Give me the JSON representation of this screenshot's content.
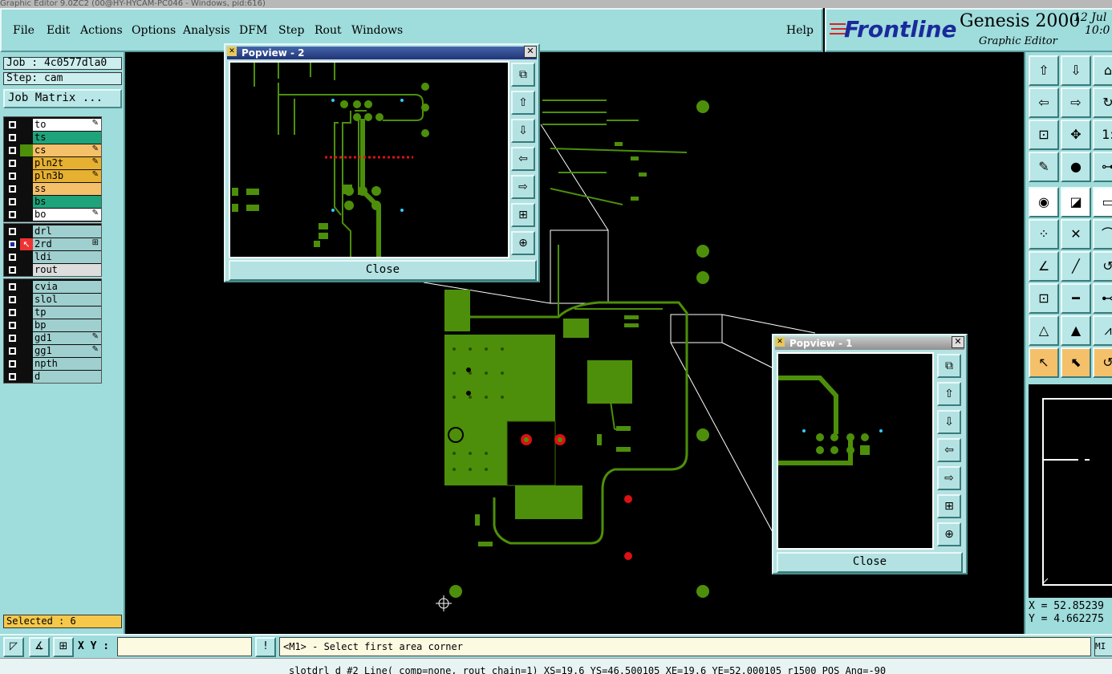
{
  "window_title": "Graphic Editor 9.0ZC2 (00@HY-HYCAM-PC046 - Windows, pid:616)",
  "menu": [
    "File",
    "Edit",
    "Actions",
    "Options",
    "Analysis",
    "DFM",
    "Step",
    "Rout",
    "Windows"
  ],
  "help_label": "Help",
  "brand": {
    "logo": "Frontline",
    "product": "Genesis 2000",
    "subtitle": "Graphic Editor",
    "date": "12 Jul",
    "time": "10:0"
  },
  "job": {
    "job_label": "Job : 4c0577dla0",
    "step_label": "Step: cam",
    "matrix_button": "Job Matrix ..."
  },
  "layers_board": [
    {
      "name": "to",
      "color": "#ffffff",
      "has_swatch": false,
      "flag": "✎"
    },
    {
      "name": "ts",
      "color": "#1fa37a",
      "has_swatch": false,
      "flag": ""
    },
    {
      "name": "cs",
      "color": "#f5c06a",
      "has_swatch": true,
      "flag": "✎"
    },
    {
      "name": "pln2t",
      "color": "#e6b030",
      "has_swatch": false,
      "flag": "✎"
    },
    {
      "name": "pln3b",
      "color": "#e6b030",
      "has_swatch": false,
      "flag": "✎"
    },
    {
      "name": "ss",
      "color": "#f5c06a",
      "has_swatch": false,
      "flag": ""
    },
    {
      "name": "bs",
      "color": "#1fa37a",
      "has_swatch": false,
      "flag": ""
    },
    {
      "name": "bo",
      "color": "#ffffff",
      "has_swatch": false,
      "flag": "✎"
    }
  ],
  "layers_drill": [
    {
      "name": "drl",
      "color": "#9fcfcf",
      "flag": ""
    },
    {
      "name": "2rd",
      "color": "#9fcfcf",
      "flag": "⊞"
    },
    {
      "name": "ldi",
      "color": "#9fcfcf",
      "flag": ""
    },
    {
      "name": "rout",
      "color": "#dddddd",
      "flag": ""
    }
  ],
  "layers_misc": [
    {
      "name": "cvia",
      "color": "#9fcfcf",
      "flag": ""
    },
    {
      "name": "slol",
      "color": "#9fcfcf",
      "flag": ""
    },
    {
      "name": "tp",
      "color": "#9fcfcf",
      "flag": ""
    },
    {
      "name": "bp",
      "color": "#9fcfcf",
      "flag": ""
    },
    {
      "name": "gd1",
      "color": "#9fcfcf",
      "flag": "✎"
    },
    {
      "name": "gg1",
      "color": "#9fcfcf",
      "flag": "✎"
    },
    {
      "name": "npth",
      "color": "#9fcfcf",
      "flag": ""
    },
    {
      "name": "d",
      "color": "#9fcfcf",
      "flag": ""
    }
  ],
  "selected_label": "Selected : 6",
  "popview2": {
    "title": "Popview - 2",
    "close_label": "Close"
  },
  "popview1": {
    "title": "Popview - 1",
    "close_label": "Close"
  },
  "coords": {
    "x": "X = 52.85239",
    "y": "Y = 4.662275"
  },
  "xy_label": "X Y :",
  "xy_value": "",
  "prompt": "<M1> - Select first area corner",
  "m_button": "MI",
  "status": "slotdrl d #2 Line( comp=none, rout chain=1) XS=19.6 YS=46.500105 XE=19.6 YE=52.000105 r1500 POS Ang=-90"
}
